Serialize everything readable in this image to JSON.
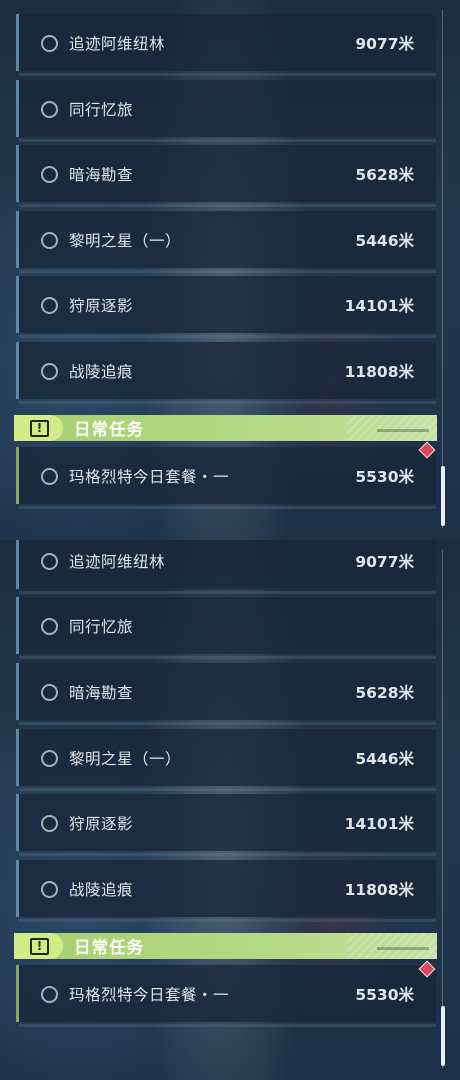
{
  "panels": [
    {
      "quests": [
        {
          "name": "追迹阿维纽林",
          "distance": "9077米"
        },
        {
          "name": "同行忆旅",
          "distance": ""
        },
        {
          "name": "暗海勘查",
          "distance": "5628米"
        },
        {
          "name": "黎明之星（一）",
          "distance": "5446米"
        },
        {
          "name": "狩原逐影",
          "distance": "14101米"
        },
        {
          "name": "战陵追痕",
          "distance": "11808米"
        }
      ],
      "daily_section": {
        "title": "日常任务",
        "icon": "exclamation-box-icon",
        "quests": [
          {
            "name": "玛格烈特今日套餐・一",
            "distance": "5530米"
          }
        ]
      }
    },
    {
      "quests": [
        {
          "name": "追迹阿维纽林",
          "distance": "9077米"
        },
        {
          "name": "同行忆旅",
          "distance": ""
        },
        {
          "name": "暗海勘查",
          "distance": "5628米"
        },
        {
          "name": "黎明之星（一）",
          "distance": "5446米"
        },
        {
          "name": "狩原逐影",
          "distance": "14101米"
        },
        {
          "name": "战陵追痕",
          "distance": "11808米"
        }
      ],
      "daily_section": {
        "title": "日常任务",
        "icon": "exclamation-box-icon",
        "quests": [
          {
            "name": "玛格烈特今日套餐・一",
            "distance": "5530米"
          }
        ]
      }
    }
  ],
  "colors": {
    "daily_accent": "#a6d06f",
    "new_badge": "#d64a5c",
    "item_border": "#5f86a3"
  }
}
